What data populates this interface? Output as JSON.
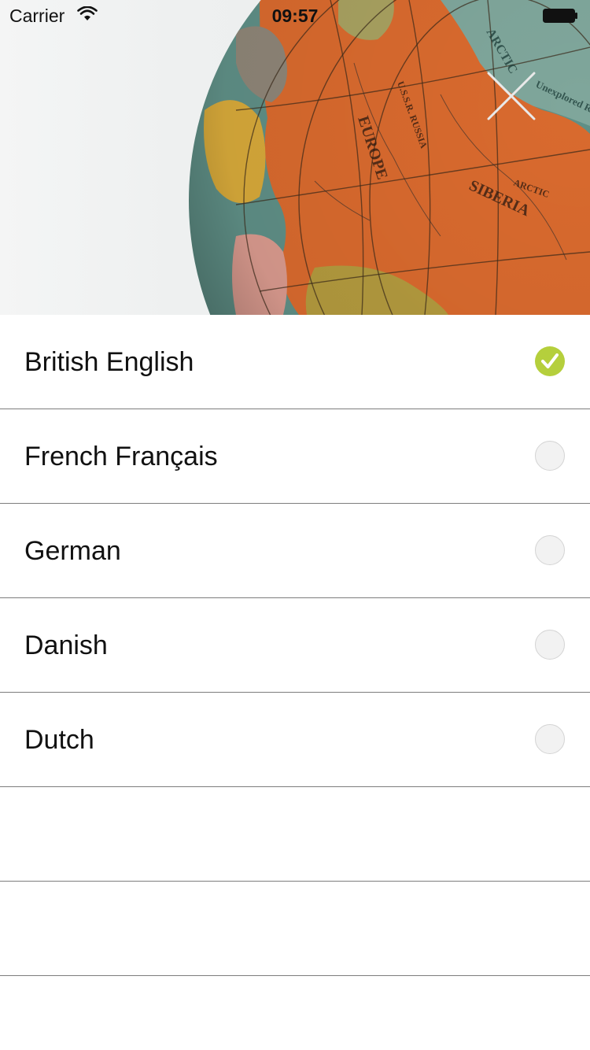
{
  "status_bar": {
    "carrier": "Carrier",
    "time": "09:57",
    "wifi_icon": "wifi-icon",
    "battery_icon": "battery-icon"
  },
  "hero": {
    "image": "globe-photo",
    "close_icon": "close-icon"
  },
  "colors": {
    "selected": "#b5cf3c",
    "divider": "#7d7d7d",
    "radio_off": "#f2f2f2"
  },
  "languages": [
    {
      "label": "British English",
      "selected": true
    },
    {
      "label": "French Français",
      "selected": false
    },
    {
      "label": "German",
      "selected": false
    },
    {
      "label": "Danish",
      "selected": false
    },
    {
      "label": "Dutch",
      "selected": false
    }
  ]
}
